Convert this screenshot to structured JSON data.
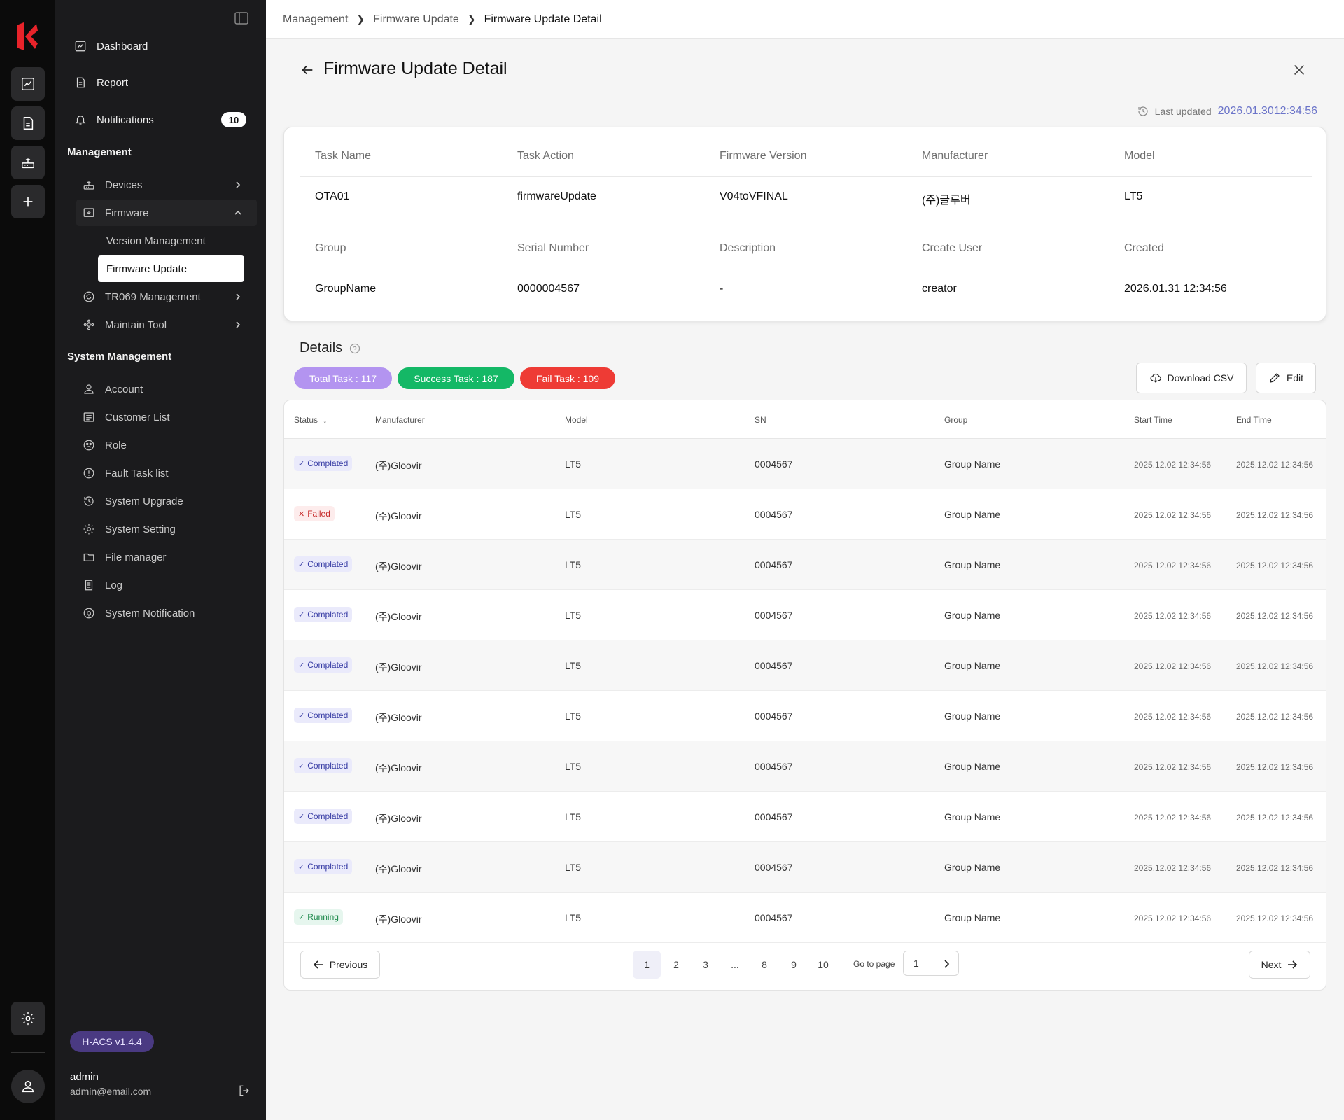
{
  "sidebar": {
    "top_items": [
      {
        "label": "Dashboard",
        "icon": "chart-icon"
      },
      {
        "label": "Report",
        "icon": "document-icon"
      },
      {
        "label": "Notifications",
        "icon": "bell-icon",
        "badge": "10"
      }
    ],
    "management_heading": "Management",
    "management_items": [
      {
        "label": "Devices",
        "icon": "router-icon"
      },
      {
        "label": "Firmware",
        "icon": "firmware-icon"
      },
      {
        "label": "Version Management"
      },
      {
        "label": "Firmware Update"
      },
      {
        "label": "TR069 Management",
        "icon": "sync-icon"
      },
      {
        "label": "Maintain Tool",
        "icon": "tool-icon"
      }
    ],
    "system_heading": "System Management",
    "system_items": [
      {
        "label": "Account",
        "icon": "user-icon"
      },
      {
        "label": "Customer List",
        "icon": "list-icon"
      },
      {
        "label": "Role",
        "icon": "role-icon"
      },
      {
        "label": "Fault Task list",
        "icon": "alert-icon"
      },
      {
        "label": "System Upgrade",
        "icon": "history-icon"
      },
      {
        "label": "System Setting",
        "icon": "gear-icon"
      },
      {
        "label": "File manager",
        "icon": "folder-icon"
      },
      {
        "label": "Log",
        "icon": "log-icon"
      },
      {
        "label": "System Notification",
        "icon": "notify-icon"
      }
    ],
    "version": "H-ACS v1.4.4",
    "user_name": "admin",
    "user_email": "admin@email.com"
  },
  "breadcrumb": [
    "Management",
    "Firmware Update",
    "Firmware Update Detail"
  ],
  "page": {
    "title": "Firmware Update Detail",
    "last_updated_label": "Last updated",
    "last_updated_value": "2026.01.3012:34:56"
  },
  "info": {
    "row1": [
      {
        "label": "Task Name",
        "value": "OTA01"
      },
      {
        "label": "Task Action",
        "value": "firmwareUpdate"
      },
      {
        "label": "Firmware Version",
        "value": "V04toVFINAL"
      },
      {
        "label": "Manufacturer",
        "value": "(주)글루버"
      },
      {
        "label": "Model",
        "value": "LT5"
      }
    ],
    "row2": [
      {
        "label": "Group",
        "value": "GroupName"
      },
      {
        "label": "Serial Number",
        "value": "0000004567"
      },
      {
        "label": "Description",
        "value": "-"
      },
      {
        "label": "Create User",
        "value": "creator"
      },
      {
        "label": "Created",
        "value": "2026.01.31 12:34:56"
      }
    ]
  },
  "details": {
    "heading": "Details",
    "pills": {
      "total": "Total Task : 117",
      "success": "Success Task : 187",
      "fail": "Fail Task : 109"
    },
    "colors": {
      "total": "#b394f0",
      "success": "#14b866",
      "fail": "#ee3b35"
    },
    "download_label": "Download CSV",
    "edit_label": "Edit"
  },
  "table": {
    "columns": [
      "Status",
      "Manufacturer",
      "Model",
      "SN",
      "Group",
      "Start Time",
      "End Time"
    ],
    "rows": [
      {
        "status": "Complated",
        "kind": "completed",
        "manufacturer": "(주)Gloovir",
        "model": "LT5",
        "sn": "0004567",
        "group": "Group Name",
        "start": "2025.12.02 12:34:56",
        "end": "2025.12.02 12:34:56"
      },
      {
        "status": "Failed",
        "kind": "failed",
        "manufacturer": "(주)Gloovir",
        "model": "LT5",
        "sn": "0004567",
        "group": "Group Name",
        "start": "2025.12.02 12:34:56",
        "end": "2025.12.02 12:34:56"
      },
      {
        "status": "Complated",
        "kind": "completed",
        "manufacturer": "(주)Gloovir",
        "model": "LT5",
        "sn": "0004567",
        "group": "Group Name",
        "start": "2025.12.02 12:34:56",
        "end": "2025.12.02 12:34:56"
      },
      {
        "status": "Complated",
        "kind": "completed",
        "manufacturer": "(주)Gloovir",
        "model": "LT5",
        "sn": "0004567",
        "group": "Group Name",
        "start": "2025.12.02 12:34:56",
        "end": "2025.12.02 12:34:56"
      },
      {
        "status": "Complated",
        "kind": "completed",
        "manufacturer": "(주)Gloovir",
        "model": "LT5",
        "sn": "0004567",
        "group": "Group Name",
        "start": "2025.12.02 12:34:56",
        "end": "2025.12.02 12:34:56"
      },
      {
        "status": "Complated",
        "kind": "completed",
        "manufacturer": "(주)Gloovir",
        "model": "LT5",
        "sn": "0004567",
        "group": "Group Name",
        "start": "2025.12.02 12:34:56",
        "end": "2025.12.02 12:34:56"
      },
      {
        "status": "Complated",
        "kind": "completed",
        "manufacturer": "(주)Gloovir",
        "model": "LT5",
        "sn": "0004567",
        "group": "Group Name",
        "start": "2025.12.02 12:34:56",
        "end": "2025.12.02 12:34:56"
      },
      {
        "status": "Complated",
        "kind": "completed",
        "manufacturer": "(주)Gloovir",
        "model": "LT5",
        "sn": "0004567",
        "group": "Group Name",
        "start": "2025.12.02 12:34:56",
        "end": "2025.12.02 12:34:56"
      },
      {
        "status": "Complated",
        "kind": "completed",
        "manufacturer": "(주)Gloovir",
        "model": "LT5",
        "sn": "0004567",
        "group": "Group Name",
        "start": "2025.12.02 12:34:56",
        "end": "2025.12.02 12:34:56"
      },
      {
        "status": "Running",
        "kind": "running",
        "manufacturer": "(주)Gloovir",
        "model": "LT5",
        "sn": "0004567",
        "group": "Group Name",
        "start": "2025.12.02 12:34:56",
        "end": "2025.12.02 12:34:56"
      }
    ]
  },
  "pagination": {
    "previous": "Previous",
    "next": "Next",
    "pages": [
      "1",
      "2",
      "3",
      "...",
      "8",
      "9",
      "10"
    ],
    "active": "1",
    "goto_label": "Go to page",
    "goto_value": "1"
  }
}
